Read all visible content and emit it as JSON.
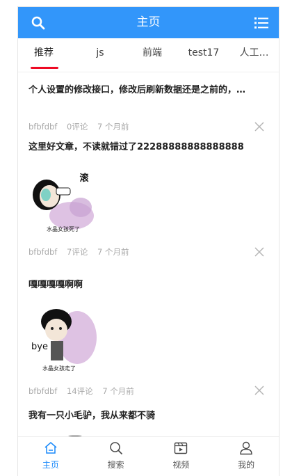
{
  "header": {
    "title": "主页"
  },
  "tabs": [
    {
      "label": "推荐"
    },
    {
      "label": "js"
    },
    {
      "label": "前端"
    },
    {
      "label": "test17"
    },
    {
      "label": "人工…"
    }
  ],
  "articles": [
    {
      "title": "个人设置的修改接口，修改后刷新数据还是之前的，…",
      "author": "bfbfdbf",
      "comments": "0评论",
      "time": "7 个月前"
    },
    {
      "title": "这里好文章，不读就错过了22288888888888888",
      "image_text": "滚",
      "image_caption": "水晶女孩死了",
      "author": "bfbfdbf",
      "comments": "7评论",
      "time": "7 个月前"
    },
    {
      "title": "嘎嘎嘎嘎啊啊",
      "image_text": "bye",
      "image_caption": "水晶女孩走了",
      "author": "bfbfdbf",
      "comments": "14评论",
      "time": "7 个月前"
    },
    {
      "title": "我有一只小毛驴，我从来都不骑"
    }
  ],
  "tabbar": [
    {
      "label": "主页",
      "icon": "home-icon"
    },
    {
      "label": "搜索",
      "icon": "search-icon"
    },
    {
      "label": "视频",
      "icon": "video-icon"
    },
    {
      "label": "我的",
      "icon": "user-icon"
    }
  ],
  "colors": {
    "header": "#3296fa",
    "active_tab_bar": "#ee0a24",
    "tabbar_active": "#1989fa"
  }
}
